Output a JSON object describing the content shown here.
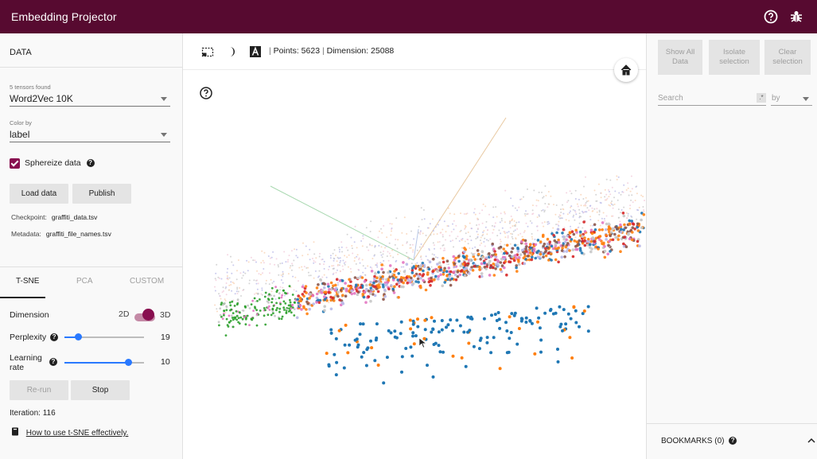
{
  "app": {
    "title": "Embedding Projector"
  },
  "header_icons": [
    "help-icon",
    "bug-icon"
  ],
  "left": {
    "heading": "DATA",
    "tensors_found": "5 tensors found",
    "tensor_selected": "Word2Vec 10K",
    "color_by_label": "Color by",
    "color_by_value": "label",
    "sphereize_label": "Sphereize data",
    "sphereize_checked": true,
    "load_button": "Load data",
    "publish_button": "Publish",
    "checkpoint_key": "Checkpoint:",
    "checkpoint_value": "graffiti_data.tsv",
    "metadata_key": "Metadata:",
    "metadata_value": "graffiti_file_names.tsv",
    "tabs": [
      "T-SNE",
      "PCA",
      "CUSTOM"
    ],
    "active_tab": "T-SNE",
    "dimension_label": "Dimension",
    "dim_2d": "2D",
    "dim_3d": "3D",
    "dimension_selected": "3D",
    "perplexity_label": "Perplexity",
    "perplexity_value": "19",
    "perplexity_fraction": 0.17,
    "learning_rate_label_1": "Learning",
    "learning_rate_label_2": "rate",
    "learning_rate_value": "10",
    "learning_rate_fraction": 0.8,
    "rerun_button": "Re-run",
    "stop_button": "Stop",
    "iteration_text": "Iteration: 116",
    "tsne_link": "How to use t-SNE effectively."
  },
  "center": {
    "points_text": "Points: 5623",
    "dimension_text": "Dimension: 25088",
    "colors": {
      "blue": "#1f77b4",
      "orange": "#ff7f0e",
      "green": "#2ca02c",
      "red": "#d62728",
      "pink": "#e377c2",
      "brown": "#8c564b",
      "gray": "#c7c7c7",
      "lavender": "#b8b8e8"
    }
  },
  "right": {
    "show_all": [
      "Show All",
      "Data"
    ],
    "isolate": [
      "Isolate",
      "selection"
    ],
    "clear": [
      "Clear",
      "selection"
    ],
    "search_placeholder": "Search",
    "regex_label": ".*",
    "by_placeholder": "by",
    "bookmarks": "BOOKMARKS (0)"
  },
  "colors": {
    "brand": "#570a30",
    "accent": "#880e4f",
    "slider": "#2979ff"
  }
}
